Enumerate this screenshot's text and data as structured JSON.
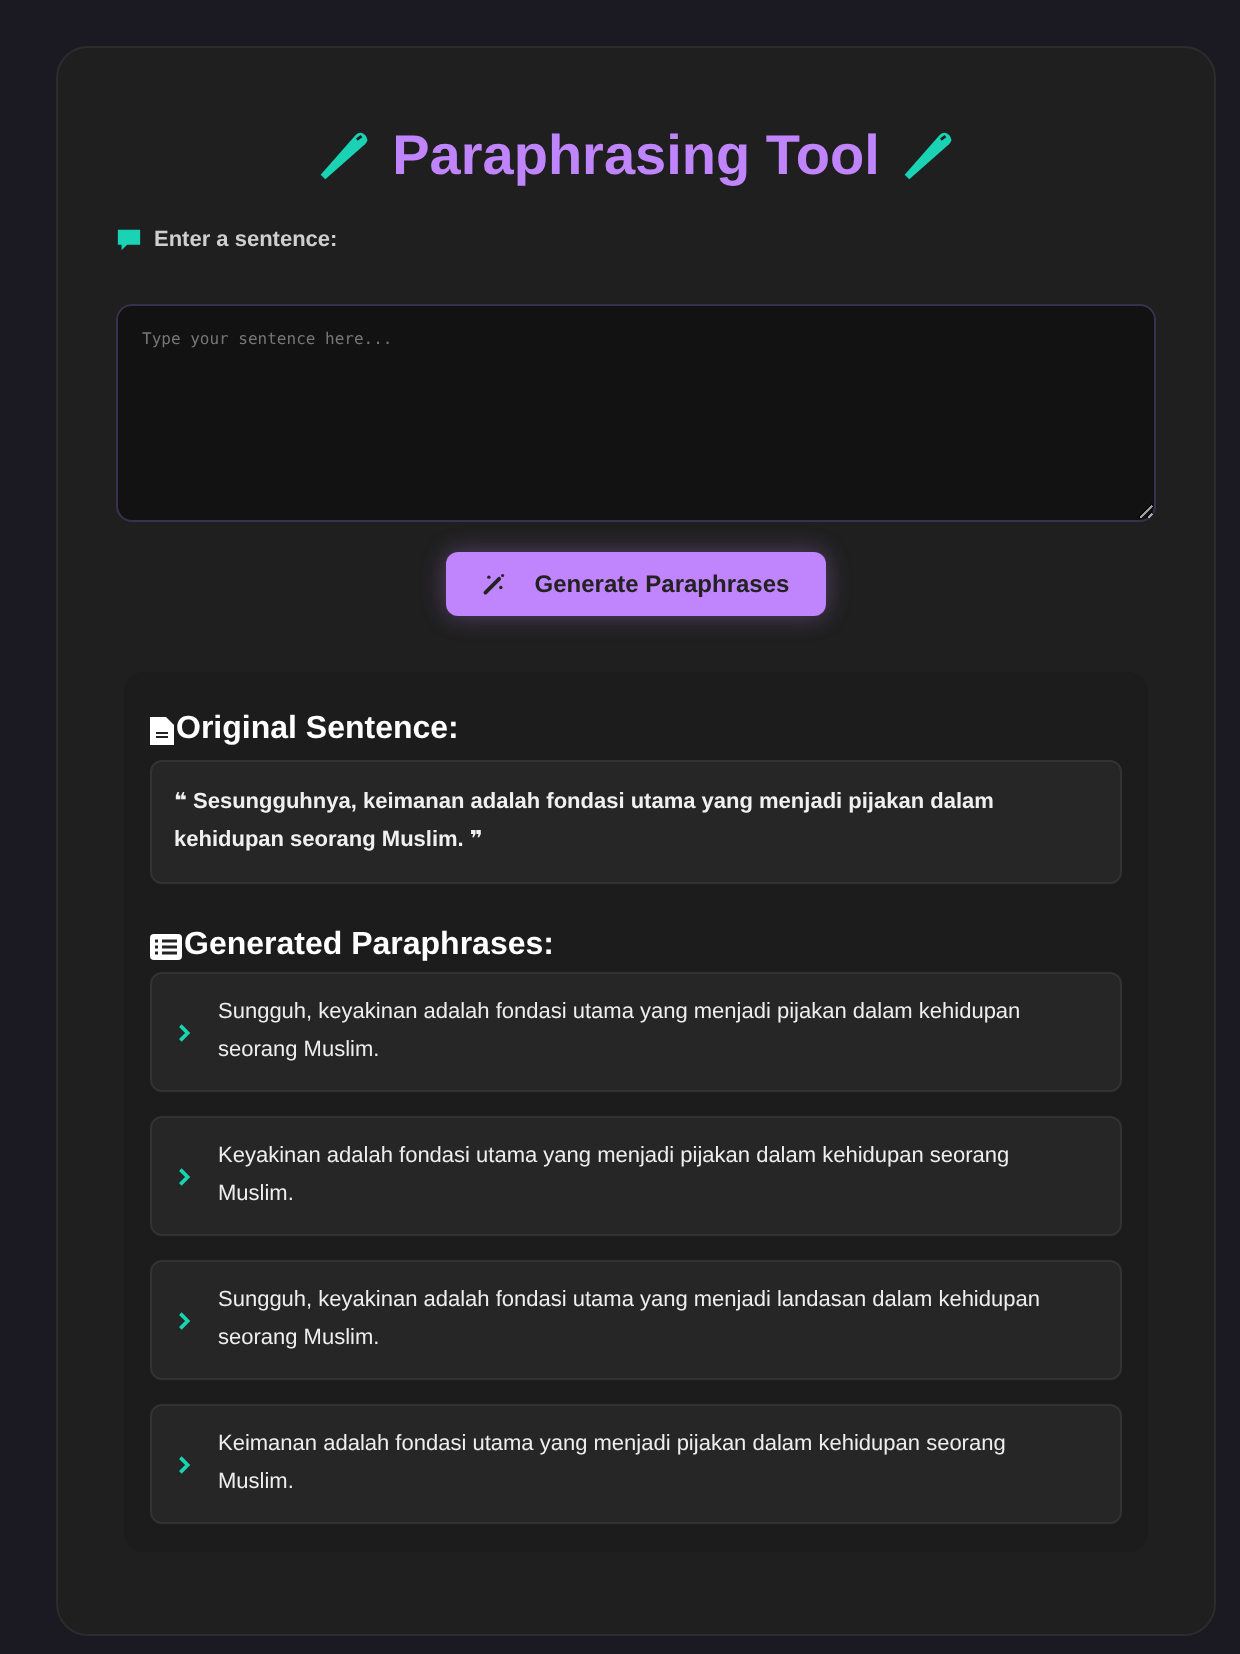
{
  "title": "Paraphrasing Tool",
  "input": {
    "label": "Enter a sentence:",
    "placeholder": "Type your sentence here..."
  },
  "generate_button": "Generate Paraphrases",
  "original": {
    "heading": "Original Sentence:",
    "sentence": "❝ Sesungguhnya, keimanan adalah fondasi utama yang menjadi pijakan dalam kehidupan seorang Muslim. ❞"
  },
  "paraphrases": {
    "heading": "Generated Paraphrases:",
    "items": [
      "Sungguh, keyakinan adalah fondasi utama yang menjadi pijakan dalam kehidupan seorang Muslim.",
      "Keyakinan adalah fondasi utama yang menjadi pijakan dalam kehidupan seorang Muslim.",
      "Sungguh, keyakinan adalah fondasi utama yang menjadi landasan dalam kehidupan seorang Muslim.",
      "Keimanan adalah fondasi utama yang menjadi pijakan dalam kehidupan seorang Muslim."
    ]
  }
}
